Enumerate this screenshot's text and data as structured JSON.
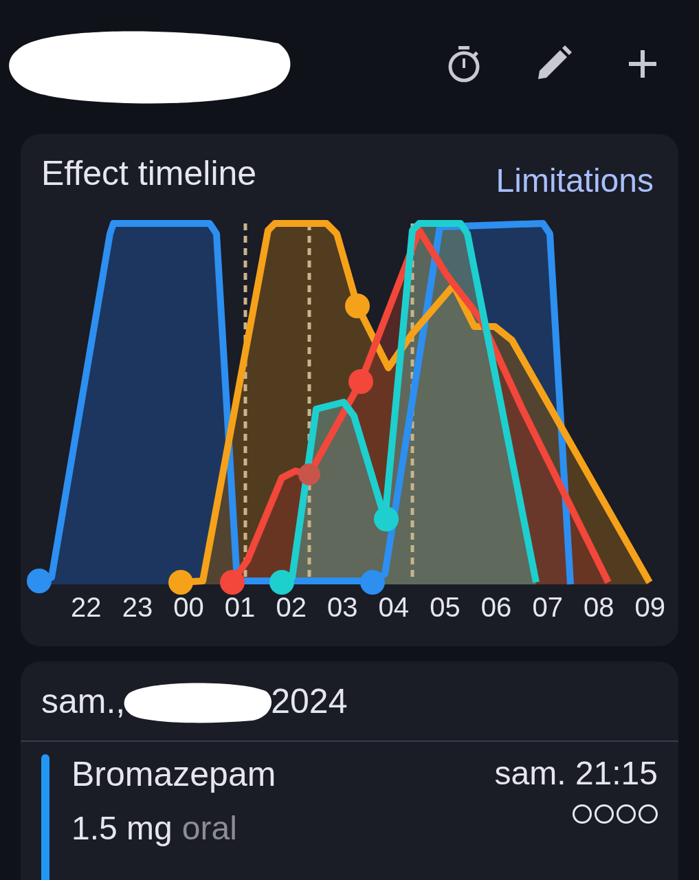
{
  "toolbar": {
    "actions": [
      {
        "kind": "timer"
      },
      {
        "kind": "edit"
      },
      {
        "kind": "add"
      }
    ]
  },
  "effect_timeline": {
    "title": "Effect timeline",
    "link": "Limitations",
    "hours": [
      "22",
      "23",
      "00",
      "01",
      "02",
      "03",
      "04",
      "05",
      "06",
      "07",
      "08",
      "09"
    ]
  },
  "day": {
    "weekday": "sam.,",
    "year": "2024",
    "entries": [
      {
        "substance": "Bromazepam",
        "dose": "1.5 mg",
        "route": "oral",
        "time": "sam. 21:15",
        "color": "#2196f3",
        "stars": 0
      }
    ]
  }
}
